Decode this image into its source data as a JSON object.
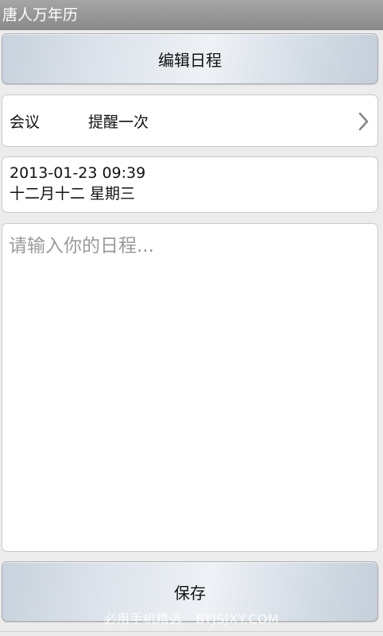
{
  "app": {
    "title": "唐人万年历"
  },
  "toolbar": {
    "edit_label": "编辑日程"
  },
  "reminder": {
    "type": "会议",
    "frequency": "提醒一次"
  },
  "datetime": {
    "date_time": "2013-01-23 09:39",
    "lunar_weekday": "十二月十二 星期三"
  },
  "schedule": {
    "placeholder": "请输入你的日程..."
  },
  "footer": {
    "save_label": "保存",
    "watermark": "必用手机精选 · BYJSJXY.COM"
  },
  "icons": {
    "reminder_arrow": "chevron-right-icon"
  }
}
